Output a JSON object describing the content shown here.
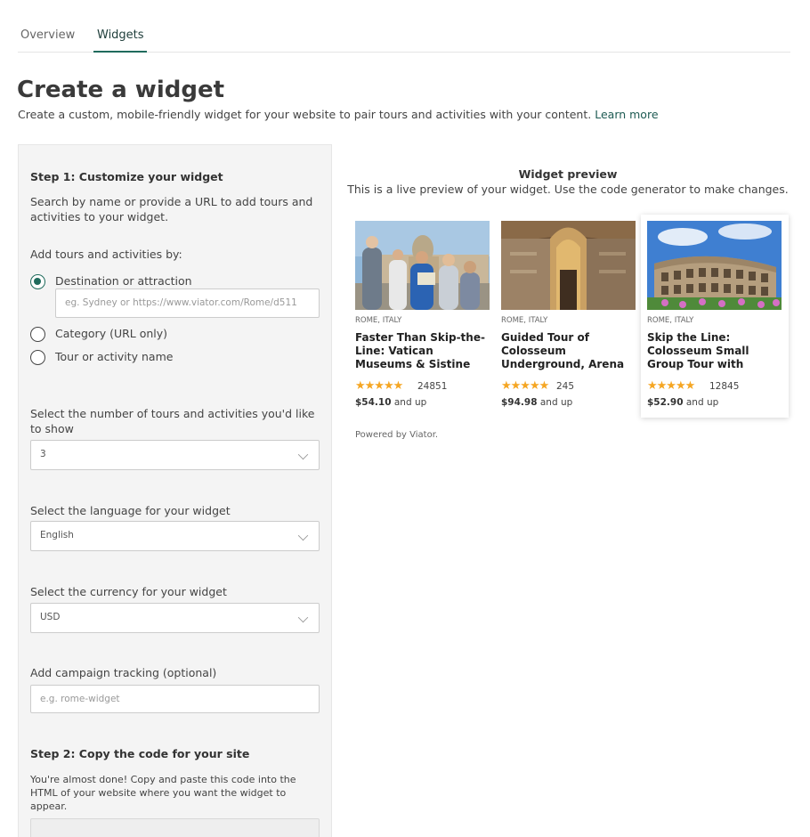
{
  "tabs": [
    {
      "label": "Overview",
      "active": false
    },
    {
      "label": "Widgets",
      "active": true
    }
  ],
  "page": {
    "title": "Create a widget",
    "subtitle": "Create a custom, mobile-friendly widget for your website to pair tours and activities with your content.",
    "learn_more": "Learn more"
  },
  "step1": {
    "title": "Step 1: Customize your widget",
    "intro": "Search by name or provide a URL to add tours and activities to your widget.",
    "add_by_label": "Add tours and activities by:",
    "options": [
      {
        "label": "Destination or attraction",
        "selected": true
      },
      {
        "label": "Category (URL only)",
        "selected": false
      },
      {
        "label": "Tour or activity name",
        "selected": false
      }
    ],
    "destination_placeholder": "eg. Sydney or https://www.viator.com/Rome/d511",
    "count_label": "Select the number of tours and activities you'd like to show",
    "count_value": "3",
    "language_label": "Select the language for your widget",
    "language_value": "English",
    "currency_label": "Select the currency for your widget",
    "currency_value": "USD",
    "campaign_label": "Add campaign tracking (optional)",
    "campaign_placeholder": "e.g. rome-widget"
  },
  "step2": {
    "title": "Step 2: Copy the code for your site",
    "text": "You're almost done! Copy and paste this code into the HTML of your website where you want the widget to appear."
  },
  "preview": {
    "title": "Widget preview",
    "subtitle": "This is a live preview of your widget. Use the code generator to make changes.",
    "powered_by": "Powered by Viator.",
    "cards": [
      {
        "location": "ROME, ITALY",
        "title": "Faster Than Skip-the-Line: Vatican Museums & Sistine Ch...",
        "rating": 4.5,
        "stars": "★★★★★",
        "reviews": "24851",
        "price": "$54.10",
        "price_suffix": "and up"
      },
      {
        "location": "ROME, ITALY",
        "title": "Guided Tour of Colosseum Underground, Arena a...",
        "rating": 5,
        "stars": "★★★★★",
        "reviews": "245",
        "price": "$94.98",
        "price_suffix": "and up"
      },
      {
        "location": "ROME, ITALY",
        "title": "Skip the Line: Colosseum Small Group Tour with Roman Foru...",
        "rating": 4.5,
        "stars": "★★★★★",
        "reviews": "12845",
        "price": "$52.90",
        "price_suffix": "and up"
      }
    ]
  },
  "colors": {
    "accent": "#1f6b5c",
    "star": "#f5a623"
  }
}
